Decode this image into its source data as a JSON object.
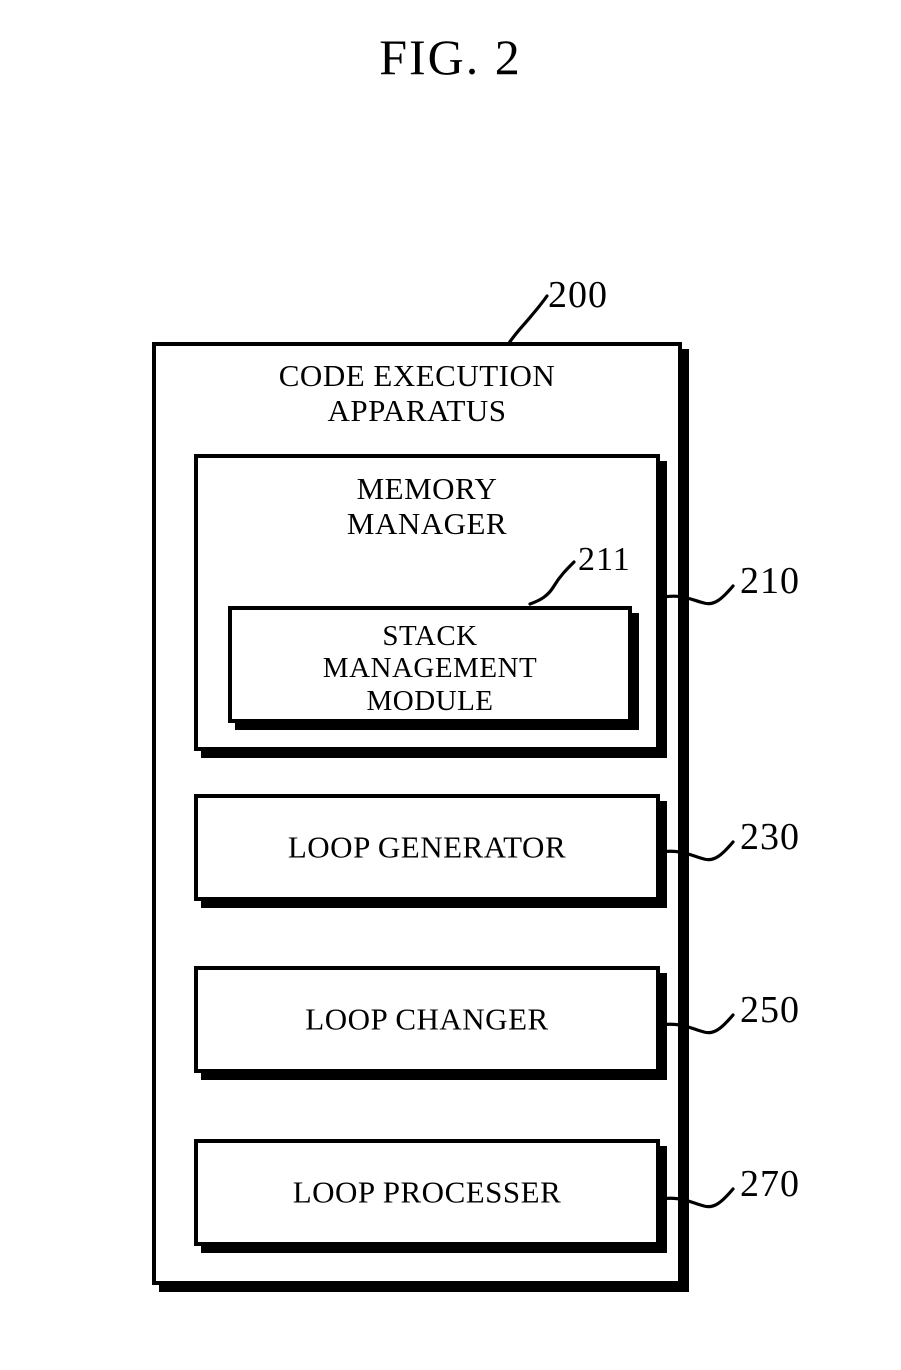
{
  "figure": {
    "title": "FIG. 2"
  },
  "apparatus": {
    "title_line1": "CODE EXECUTION",
    "title_line2": "APPARATUS",
    "ref": "200"
  },
  "modules": [
    {
      "name": "memory-manager",
      "label_line1": "MEMORY",
      "label_line2": "MANAGER",
      "ref": "210",
      "submodule": {
        "name": "stack-management-module",
        "label_line1": "STACK",
        "label_line2": "MANAGEMENT",
        "label_line3": "MODULE",
        "ref": "211"
      }
    },
    {
      "name": "loop-generator",
      "label": "LOOP GENERATOR",
      "ref": "230"
    },
    {
      "name": "loop-changer",
      "label": "LOOP CHANGER",
      "ref": "250"
    },
    {
      "name": "loop-processer",
      "label": "LOOP PROCESSER",
      "ref": "270"
    }
  ],
  "style": {
    "ink_color": "#000000",
    "background_color": "#ffffff"
  }
}
